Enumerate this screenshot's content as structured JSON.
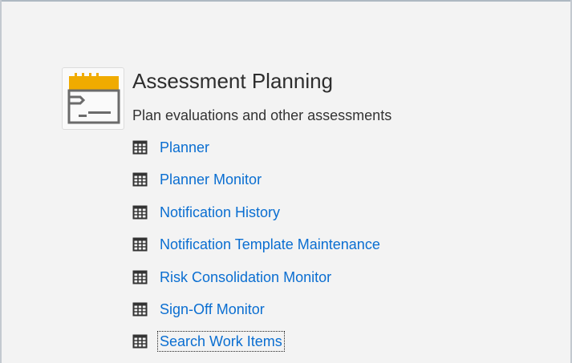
{
  "app": {
    "title": "Assessment Planning",
    "subtitle": "Plan evaluations and other assessments",
    "icon": "calendar-planning-icon"
  },
  "links": [
    {
      "label": "Planner",
      "icon": "table-icon"
    },
    {
      "label": "Planner Monitor",
      "icon": "table-icon"
    },
    {
      "label": "Notification History",
      "icon": "table-icon"
    },
    {
      "label": "Notification Template Maintenance",
      "icon": "table-icon"
    },
    {
      "label": "Risk Consolidation Monitor",
      "icon": "table-icon"
    },
    {
      "label": "Sign-Off Monitor",
      "icon": "table-icon"
    },
    {
      "label": "Search Work Items",
      "icon": "table-icon",
      "focused": true
    }
  ],
  "colors": {
    "link": "#0a6ed1",
    "accent": "#f0ab00",
    "background": "#f3f3f3"
  }
}
